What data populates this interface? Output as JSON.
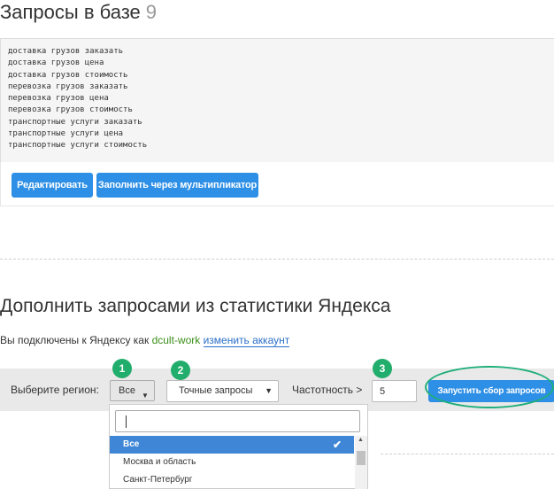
{
  "base": {
    "title": "Запросы в базе",
    "count": "9",
    "queries": [
      "доставка грузов заказать",
      "доставка грузов цена",
      "доставка грузов стоимость",
      "перевозка грузов заказать",
      "перевозка грузов цена",
      "перевозка грузов стоимость",
      "транспортные услуги заказать",
      "транспортные услуги цена",
      "транспортные услуги стоимость"
    ],
    "edit_label": "Редактировать",
    "multiplier_label": "Заполнить через мультипликатор"
  },
  "yandex": {
    "title": "Дополнить запросами из статистики Яндекса",
    "connected_prefix": "Вы подключены к Яндексу как",
    "username": "dcult-work",
    "change_account": "изменить аккаунт",
    "region_label": "Выберите регион:",
    "region_value": "Все",
    "type_value": "Точные запросы",
    "frequency_label": "Частотность >",
    "frequency_value": "5",
    "run_label": "Запустить сбор запросов",
    "badges": [
      "1",
      "2",
      "3"
    ],
    "dropdown": {
      "search_value": "",
      "items": [
        {
          "label": "Все",
          "selected": true
        },
        {
          "label": "Москва и область",
          "selected": false
        },
        {
          "label": "Санкт-Петербург",
          "selected": false
        }
      ]
    }
  },
  "colors": {
    "primary": "#2d8fe6",
    "badge": "#21ad6b",
    "selected": "#3f87d6",
    "username": "#3c8f1a",
    "link": "#2a6fc9"
  },
  "icons": {
    "caret": "caret-down-icon",
    "select_arrow": "triangle-down-icon",
    "check": "check-icon",
    "scroll_up": "arrow-up-icon"
  }
}
